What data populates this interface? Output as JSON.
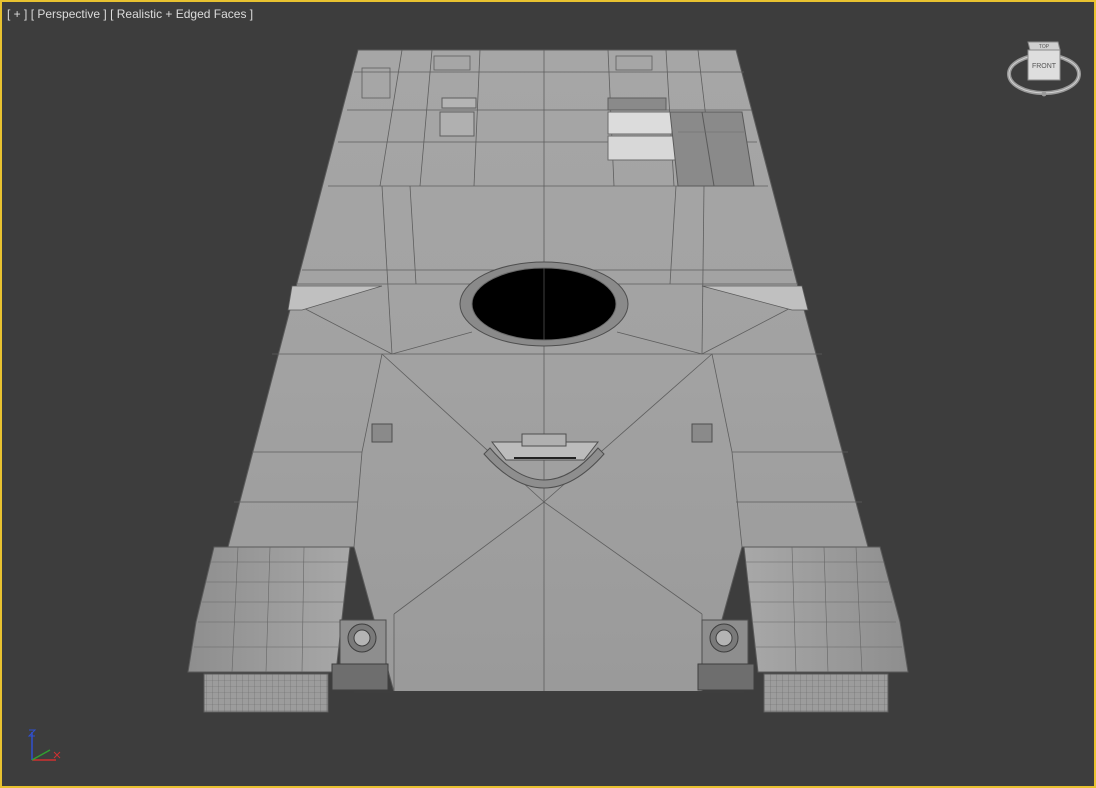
{
  "viewport": {
    "label": {
      "plus_menu": "[ + ]",
      "view_menu": "[ Perspective ]",
      "shading_menu": "[ Realistic + Edged Faces ]"
    },
    "border_color": "#e8c230",
    "background_color": "#3d3d3d"
  },
  "viewcube": {
    "front_label": "FRONT",
    "top_label": "TOP"
  },
  "axis_gizmo": {
    "x_color": "#d03030",
    "y_color": "#30a030",
    "z_color": "#3050d0"
  },
  "model": {
    "icon": "tank-hull-mesh",
    "hull_color": "#a4a4a4",
    "wire_color": "#5a5a5a"
  }
}
